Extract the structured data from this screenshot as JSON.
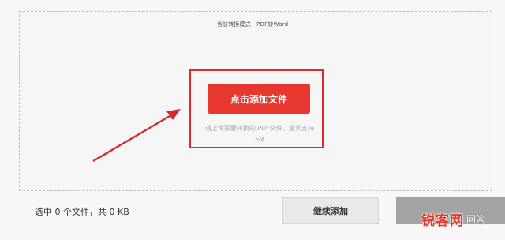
{
  "header": {
    "mode_label": "当前转换模式：PDF转Word"
  },
  "upload": {
    "add_file_label": "点击添加文件",
    "hint": "请上传需要转换的.PDF文件，最大支持5M"
  },
  "footer": {
    "status": "选中 0 个文件，共 0 KB",
    "continue_label": "继续添加"
  },
  "watermark": {
    "logo": "锐客网",
    "suffix": "问答"
  },
  "colors": {
    "accent": "#e7382f",
    "highlight": "#e02a2a"
  }
}
